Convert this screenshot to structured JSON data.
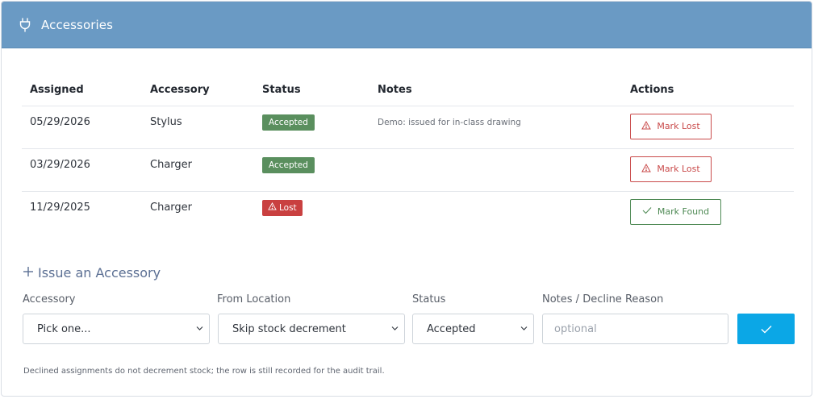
{
  "header": {
    "title": "Accessories",
    "icon": "plug-icon"
  },
  "table": {
    "columns": [
      "Assigned",
      "Accessory",
      "Status",
      "Notes",
      "Actions"
    ],
    "rows": [
      {
        "assigned": "05/29/2026",
        "accessory": "Stylus",
        "status": "Accepted",
        "notes": "Demo: issued for in-class drawing",
        "action": "Mark Lost"
      },
      {
        "assigned": "03/29/2026",
        "accessory": "Charger",
        "status": "Accepted",
        "notes": "",
        "action": "Mark Lost"
      },
      {
        "assigned": "11/29/2025",
        "accessory": "Charger",
        "status": "Lost",
        "notes": "",
        "action": "Mark Found"
      }
    ]
  },
  "issue_form": {
    "title": "Issue an Accessory",
    "accessory_label": "Accessory",
    "accessory_value": "Pick one...",
    "location_label": "From Location",
    "location_value": "Skip stock decrement",
    "status_label": "Status",
    "status_value": "Accepted",
    "notes_label": "Notes / Decline Reason",
    "notes_placeholder": "optional",
    "submit_icon": "check-icon"
  },
  "footnote": "Declined assignments do not decrement stock; the row is still recorded for the audit trail.",
  "colors": {
    "header_bg": "#6a9ac4",
    "accepted": "#5a8f5e",
    "lost": "#c94040",
    "found": "#4f8a55",
    "primary": "#0ba7e6",
    "issue_title": "#5b6f93"
  }
}
